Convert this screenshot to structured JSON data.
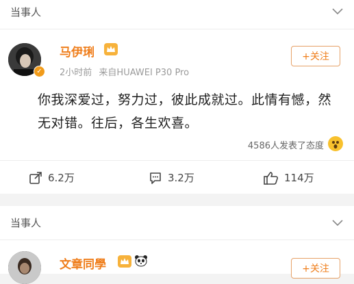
{
  "section_label": "当事人",
  "posts": [
    {
      "username": "马伊琍",
      "time": "2小时前",
      "source": "来自HUAWEI P30 Pro",
      "follow_label": "+关注",
      "content": "你我深爱过，努力过，彼此成就过。此情有憾，然无对错。往后，各生欢喜。",
      "reactions": "4586人发表了态度",
      "share_count": "6.2万",
      "comment_count": "3.2万",
      "like_count": "114万"
    },
    {
      "username": "文章同學",
      "follow_label": "+关注"
    }
  ],
  "colors": {
    "accent": "#ef7d1a",
    "verified": "#f19b1a",
    "background": "#f3f3f3"
  },
  "icons": [
    "chevron-down-icon",
    "verified-icon",
    "vip-crown-icon",
    "share-icon",
    "comment-icon",
    "like-icon",
    "wow-emoji-icon",
    "panda-icon"
  ]
}
